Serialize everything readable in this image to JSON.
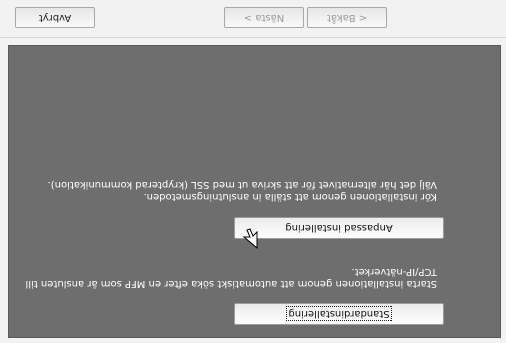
{
  "options": [
    {
      "button_label": "Standardinstallering",
      "description_line1": "Starta installationen genom att automatiskt söka efter en MFP som är ansluten till",
      "description_line2": "TCP/IP-nätverket."
    },
    {
      "button_label": "Anpassad installering",
      "description_line1": "Kör installationen genom att ställa in anslutningsmetoden.",
      "description_line2": "Välj det här alternativet för att skriva ut med SSL (krypterad kommunikation)."
    }
  ],
  "nav": {
    "back_label": "< Bakåt",
    "next_label": "Nästa >",
    "cancel_label": "Avbryt"
  }
}
